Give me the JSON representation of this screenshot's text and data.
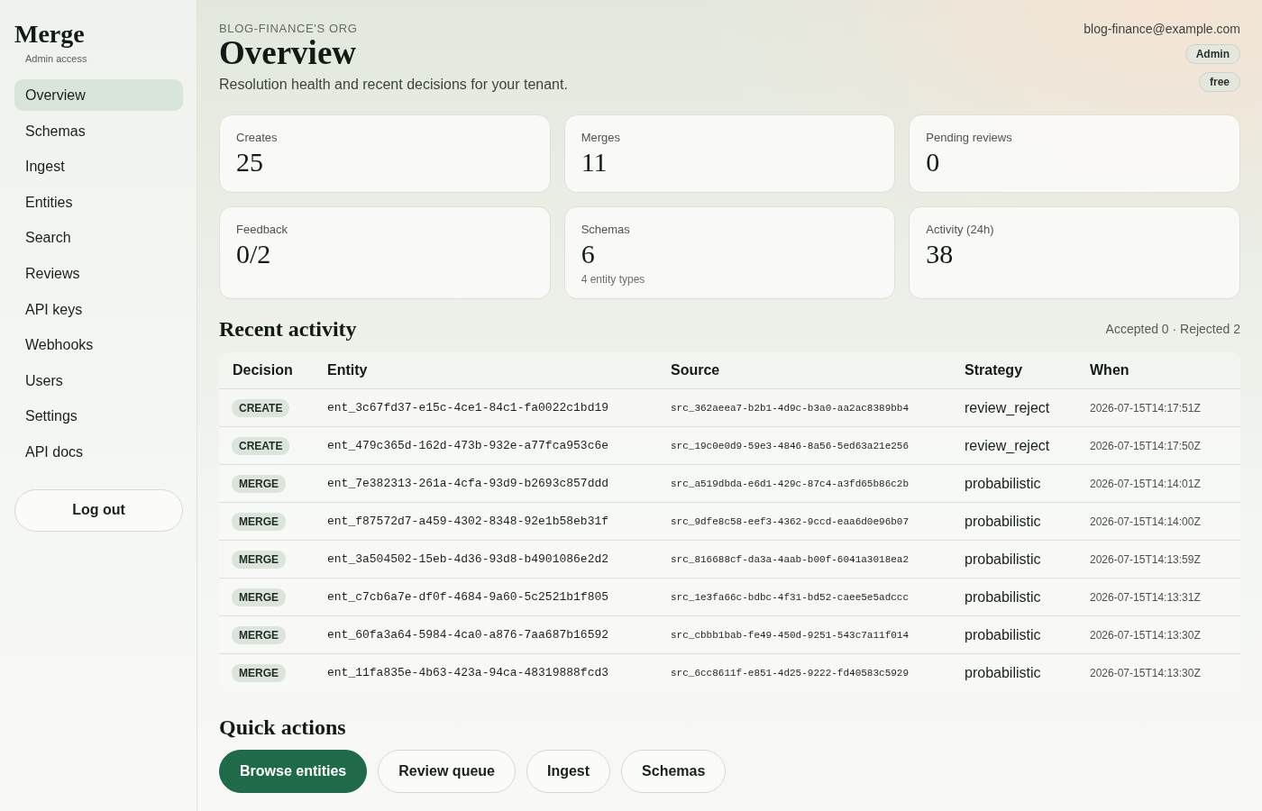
{
  "sidebar": {
    "logo": "Merge",
    "subtitle": "Admin access",
    "items": [
      {
        "label": "Overview",
        "selected": true
      },
      {
        "label": "Schemas",
        "selected": false
      },
      {
        "label": "Ingest",
        "selected": false
      },
      {
        "label": "Entities",
        "selected": false
      },
      {
        "label": "Search",
        "selected": false
      },
      {
        "label": "Reviews",
        "selected": false
      },
      {
        "label": "API keys",
        "selected": false
      },
      {
        "label": "Webhooks",
        "selected": false
      },
      {
        "label": "Users",
        "selected": false
      },
      {
        "label": "Settings",
        "selected": false
      },
      {
        "label": "API docs",
        "selected": false
      }
    ],
    "logout_button": "Log out"
  },
  "header": {
    "org": "BLOG-FINANCE'S ORG",
    "title": "Overview",
    "subtitle": "Resolution health and recent decisions for your tenant.",
    "email": "blog-finance@example.com",
    "badges": [
      "Admin",
      "free"
    ]
  },
  "stats": [
    {
      "label": "Creates",
      "value": "25"
    },
    {
      "label": "Merges",
      "value": "11"
    },
    {
      "label": "Pending reviews",
      "value": "0"
    },
    {
      "label": "Feedback",
      "value": "0/2"
    },
    {
      "label": "Schemas",
      "value": "6",
      "note": "4 entity types"
    },
    {
      "label": "Activity (24h)",
      "value": "38"
    }
  ],
  "recent_activity": {
    "title": "Recent activity",
    "summary": "Accepted 0 · Rejected 2",
    "table": {
      "columns": [
        "Decision",
        "Entity",
        "Source",
        "Strategy",
        "When"
      ],
      "rows": [
        {
          "decision": "CREATE",
          "entity": "ent_3c67fd37-e15c-4ce1-84c1-fa0022c1bd19",
          "source": "src_362aeea7-b2b1-4d9c-b3a0-aa2ac8389bb4",
          "strategy": "review_reject",
          "when": "2026-07-15T14:17:51Z"
        },
        {
          "decision": "CREATE",
          "entity": "ent_479c365d-162d-473b-932e-a77fca953c6e",
          "source": "src_19c0e0d9-59e3-4846-8a56-5ed63a21e256",
          "strategy": "review_reject",
          "when": "2026-07-15T14:17:50Z"
        },
        {
          "decision": "MERGE",
          "entity": "ent_7e382313-261a-4cfa-93d9-b2693c857ddd",
          "source": "src_a519dbda-e6d1-429c-87c4-a3fd65b86c2b",
          "strategy": "probabilistic",
          "when": "2026-07-15T14:14:01Z"
        },
        {
          "decision": "MERGE",
          "entity": "ent_f87572d7-a459-4302-8348-92e1b58eb31f",
          "source": "src_9dfe8c58-eef3-4362-9ccd-eaa6d0e96b07",
          "strategy": "probabilistic",
          "when": "2026-07-15T14:14:00Z"
        },
        {
          "decision": "MERGE",
          "entity": "ent_3a504502-15eb-4d36-93d8-b4901086e2d2",
          "source": "src_816688cf-da3a-4aab-b00f-6041a3018ea2",
          "strategy": "probabilistic",
          "when": "2026-07-15T14:13:59Z"
        },
        {
          "decision": "MERGE",
          "entity": "ent_c7cb6a7e-df0f-4684-9a60-5c2521b1f805",
          "source": "src_1e3fa66c-bdbc-4f31-bd52-caee5e5adccc",
          "strategy": "probabilistic",
          "when": "2026-07-15T14:13:31Z"
        },
        {
          "decision": "MERGE",
          "entity": "ent_60fa3a64-5984-4ca0-a876-7aa687b16592",
          "source": "src_cbbb1bab-fe49-450d-9251-543c7a11f014",
          "strategy": "probabilistic",
          "when": "2026-07-15T14:13:30Z"
        },
        {
          "decision": "MERGE",
          "entity": "ent_11fa835e-4b63-423a-94ca-48319888fcd3",
          "source": "src_6cc8611f-e851-4d25-9222-fd40583c5929",
          "strategy": "probabilistic",
          "when": "2026-07-15T14:13:30Z"
        }
      ]
    }
  },
  "quick_actions": {
    "title": "Quick actions",
    "buttons": [
      {
        "label": "Browse entities",
        "kind": "primary"
      },
      {
        "label": "Review queue",
        "kind": "secondary"
      },
      {
        "label": "Ingest",
        "kind": "secondary"
      },
      {
        "label": "Schemas",
        "kind": "secondary"
      }
    ]
  }
}
